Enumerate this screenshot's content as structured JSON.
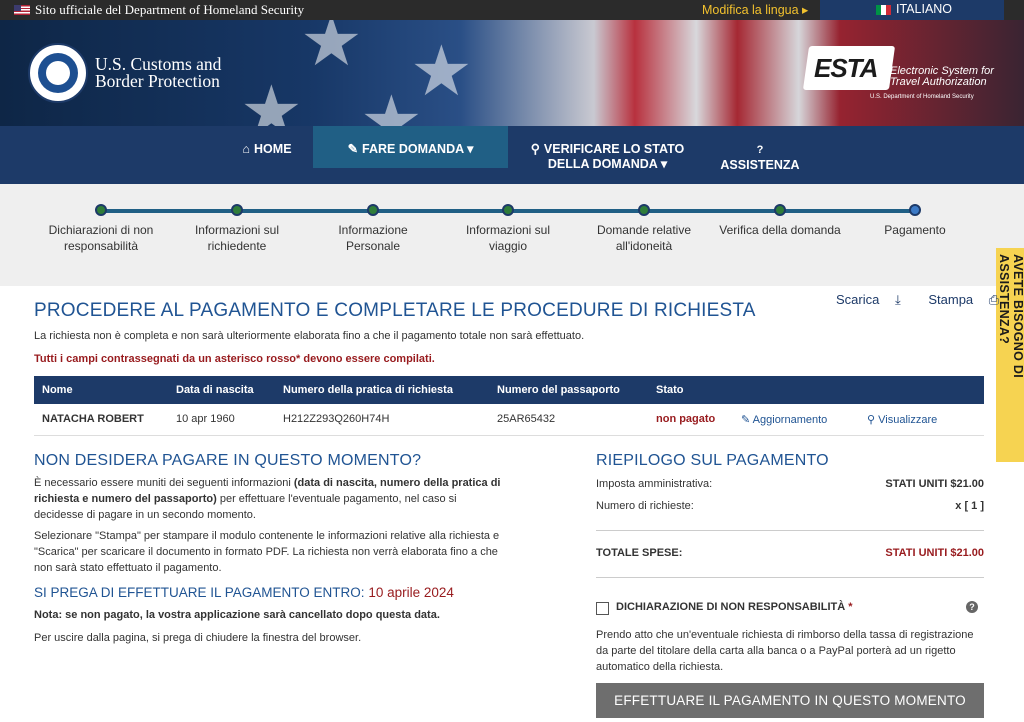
{
  "topbar": {
    "official": "Sito ufficiale del Department of Homeland Security",
    "change_language": "Modifica la lingua ▸",
    "current_language": "ITALIANO"
  },
  "header": {
    "agency_line1": "U.S. Customs and",
    "agency_line2": "Border Protection",
    "esta_word": "ESTA",
    "esta_sub": "Electronic System for Travel Authorization",
    "esta_dhs": "U.S. Department of Homeland Security"
  },
  "nav": {
    "home": "HOME",
    "apply": "FARE DOMANDA ▾",
    "status_line1": "VERIFICARE LO STATO",
    "status_line2": "DELLA DOMANDA ▾",
    "help": "ASSISTENZA"
  },
  "steps": [
    {
      "l1": "Dichiarazioni di non",
      "l2": "responsabilità"
    },
    {
      "l1": "Informazioni sul",
      "l2": "richiedente"
    },
    {
      "l1": "Informazione",
      "l2": "Personale"
    },
    {
      "l1": "Informazioni sul",
      "l2": "viaggio"
    },
    {
      "l1": "Domande relative",
      "l2": "all'idoneità"
    },
    {
      "l1": "Verifica della domanda",
      "l2": ""
    },
    {
      "l1": "Pagamento",
      "l2": ""
    }
  ],
  "help_tab": "AVETE BISOGNO DI ASSISTENZA?",
  "main": {
    "title": "PROCEDERE AL PAGAMENTO E COMPLETARE LE PROCEDURE DI RICHIESTA",
    "download": "Scarica",
    "print": "Stampa",
    "intro": "La richiesta non è completa e non sarà ulteriormente elaborata fino a che il pagamento totale non sarà effettuato.",
    "required": "Tutti i campi contrassegnati da un asterisco rosso* devono essere compilati."
  },
  "table": {
    "headers": [
      "Nome",
      "Data di nascita",
      "Numero della pratica di richiesta",
      "Numero del passaporto",
      "Stato",
      "",
      ""
    ],
    "row": {
      "name": "NATACHA ROBERT",
      "dob": "10 apr 1960",
      "app_number": "H212Z293Q260H74H",
      "passport": "25AR65432",
      "status": "non pagato",
      "update": "Aggiornamento",
      "view": "Visualizzare"
    }
  },
  "later": {
    "title": "NON DESIDERA PAGARE IN QUESTO MOMENTO?",
    "p1_a": "È necessario essere muniti dei seguenti informazioni ",
    "p1_b": "(data di nascita, numero della pratica di richiesta e numero del passaporto)",
    "p1_c": " per effettuare l'eventuale pagamento, nel caso si decidesse di pagare in un secondo momento.",
    "p2": "Selezionare \"Stampa\" per stampare il modulo contenente le informazioni relative alla richiesta e \"Scarica\" per scaricare il documento in formato PDF. La richiesta non verrà elaborata fino a che non sarà stato effettuato il pagamento.",
    "deadline_label": "SI PREGA DI EFFETTUARE IL PAGAMENTO ENTRO: ",
    "deadline_date": "10 aprile 2024",
    "note": "Nota: se non pagato, la vostra applicazione sarà cancellato dopo questa data.",
    "exit": "Per uscire dalla pagina, si prega di chiudere la finestra del browser."
  },
  "summary": {
    "title": "RIEPILOGO SUL PAGAMENTO",
    "fee_label": "Imposta amministrativa:",
    "fee_value": "STATI UNITI $21.00",
    "count_label": "Numero di richieste:",
    "count_value": "x [ 1 ]",
    "total_label": "TOTALE SPESE:",
    "total_value": "STATI UNITI $21.00"
  },
  "disclaimer": {
    "label": "DICHIARAZIONE DI NON RESPONSABILITÀ",
    "asterisk": " *",
    "text": "Prendo atto che un'eventuale richiesta di rimborso della tassa di registrazione da parte del titolare della carta alla banca o a PayPal porterà ad un rigetto automatico della richiesta."
  },
  "pay_button": "EFFETTUARE IL PAGAMENTO IN QUESTO MOMENTO"
}
